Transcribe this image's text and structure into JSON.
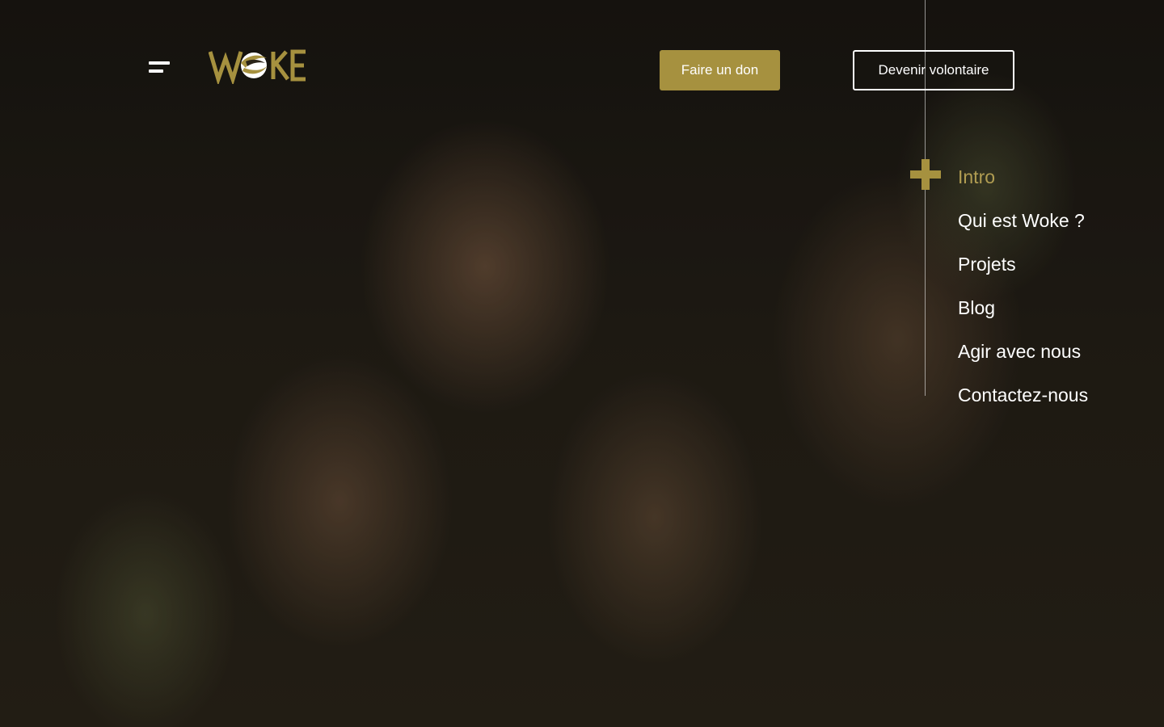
{
  "header": {
    "logo_text": "WOKE",
    "menu_icon": "hamburger-menu-icon",
    "donate_label": "Faire un don",
    "volunteer_label": "Devenir volontaire"
  },
  "side_nav": {
    "active_icon": "plus-icon",
    "items": [
      {
        "label": "Intro",
        "active": true
      },
      {
        "label": "Qui est Woke ?",
        "active": false
      },
      {
        "label": "Projets",
        "active": false
      },
      {
        "label": "Blog",
        "active": false
      },
      {
        "label": "Agir avec nous",
        "active": false
      },
      {
        "label": "Contactez-nous",
        "active": false
      }
    ]
  },
  "colors": {
    "accent_gold": "#a6913f",
    "active_nav_gold": "#b19d52",
    "text_white": "#ffffff"
  }
}
